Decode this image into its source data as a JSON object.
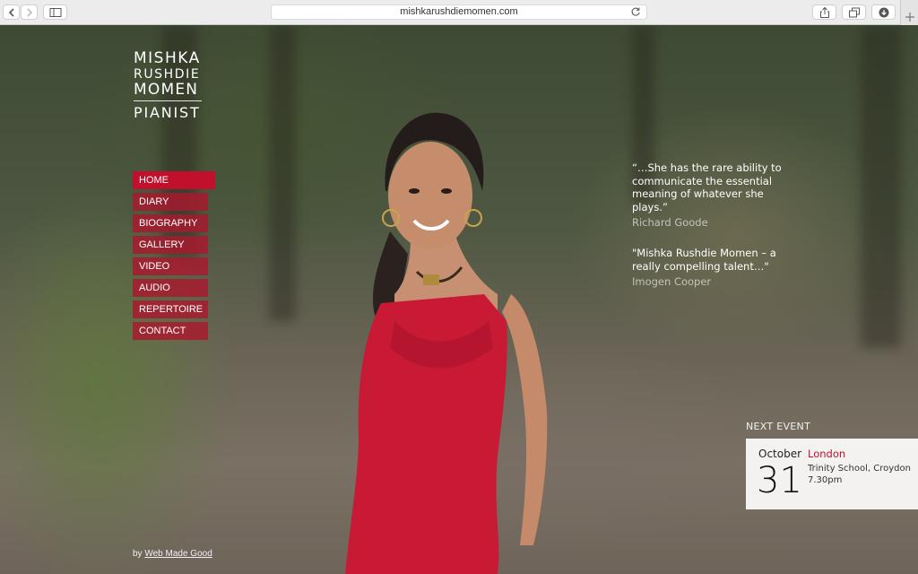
{
  "browser": {
    "url": "mishkarushdiemomen.com"
  },
  "logo": {
    "line1": "MISHKA",
    "line2": "RUSHDIE",
    "line3": "MOMEN",
    "line4": "PIANIST"
  },
  "nav": {
    "items": [
      {
        "label": "HOME"
      },
      {
        "label": "DIARY"
      },
      {
        "label": "BIOGRAPHY"
      },
      {
        "label": "GALLERY"
      },
      {
        "label": "VIDEO"
      },
      {
        "label": "AUDIO"
      },
      {
        "label": "REPERTOIRE"
      },
      {
        "label": "CONTACT"
      }
    ]
  },
  "quotes": [
    {
      "text": "“…She has the rare ability to communicate the essential meaning of whatever she plays.”",
      "author": "Richard Goode"
    },
    {
      "text": "\"Mishka Rushdie Momen – a really compelling talent…\"",
      "author": "Imogen Cooper"
    }
  ],
  "next_event": {
    "label": "NEXT EVENT",
    "month": "October",
    "day": "31",
    "city": "London",
    "venue": "Trinity School, Croydon",
    "time": "7.30pm"
  },
  "credit": {
    "prefix": "by",
    "link": "Web Made Good"
  },
  "colors": {
    "accent": "#c0102c"
  }
}
